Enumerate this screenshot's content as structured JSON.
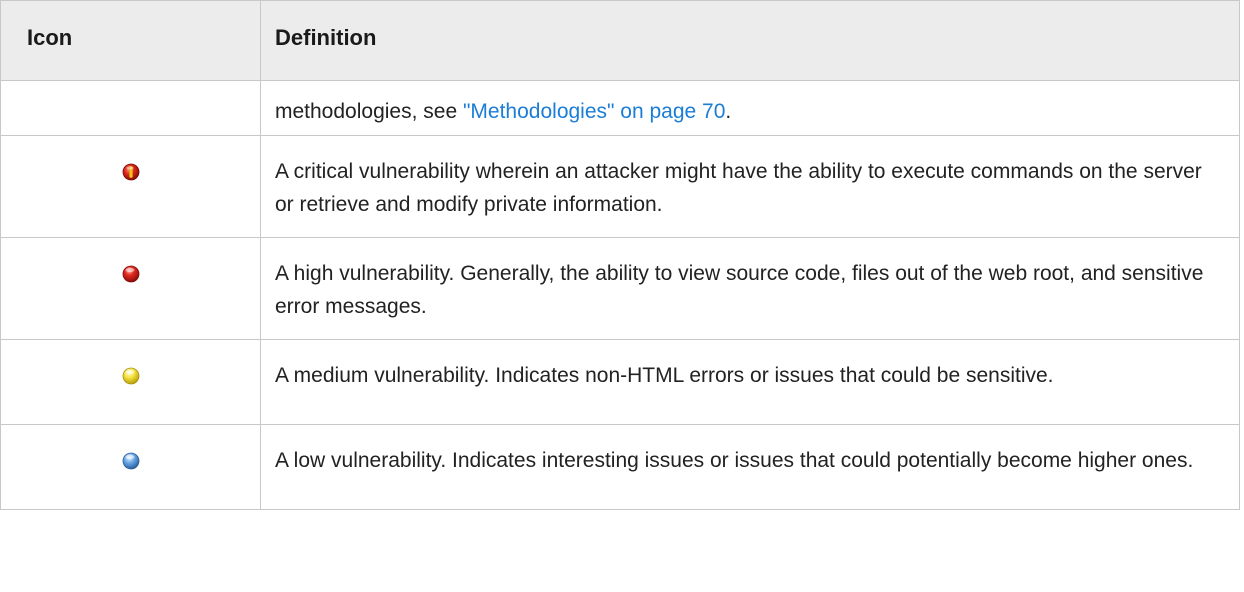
{
  "table": {
    "headers": {
      "icon": "Icon",
      "definition": "Definition"
    },
    "continuation": {
      "text_before": "methodologies, see ",
      "link_text": "\"Methodologies\" on page 70",
      "text_after": "."
    },
    "rows": [
      {
        "severity": "critical",
        "icon": "critical-severity-icon",
        "color": "#d8261c",
        "definition": "A critical vulnerability wherein an attacker might have the ability to execute commands on the server or retrieve and modify private information."
      },
      {
        "severity": "high",
        "icon": "high-severity-icon",
        "color": "#d8261c",
        "definition": "A high vulnerability. Generally, the ability to view source code, files out of the web root, and sensitive error messages."
      },
      {
        "severity": "medium",
        "icon": "medium-severity-icon",
        "color": "#f2e23a",
        "definition": "A medium vulnerability. Indicates non-HTML errors or issues that could be sensitive."
      },
      {
        "severity": "low",
        "icon": "low-severity-icon",
        "color": "#5e9ee0",
        "definition": "A low vulnerability. Indicates interesting issues or issues that could potentially become higher ones."
      }
    ],
    "link_color": "#1b7dd6"
  }
}
